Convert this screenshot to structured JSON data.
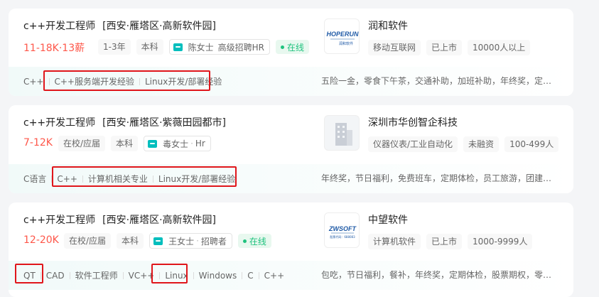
{
  "jobs": [
    {
      "title": "c++开发工程师",
      "area": "[西安·雁塔区·高新软件园]",
      "salary": "11-18K·13薪",
      "tags": [
        "1-3年",
        "本科"
      ],
      "hr": {
        "name": "陈女士",
        "title": "高级招聘HR"
      },
      "online": "在线",
      "company": {
        "name": "润和软件",
        "logo_text": "HOPERUN",
        "logo_sub": "润和软件",
        "logo_color": "#1f5aa6",
        "tags": [
          "移动互联网",
          "已上市",
          "10000人以上"
        ]
      },
      "skills": [
        "C++",
        "C++服务端开发经验",
        "Linux开发/部署经验"
      ],
      "benefits": "五险一金，零食下午茶，交通补助，加班补助，年终奖，定…"
    },
    {
      "title": "c++开发工程师",
      "area": "[西安·雁塔区·紫薇田园都市]",
      "salary": "7-12K",
      "tags": [
        "在校/应届",
        "本科"
      ],
      "hr": {
        "name": "毒女士",
        "title": "Hr"
      },
      "company": {
        "name": "深圳市华创智企科技",
        "tags": [
          "仪器仪表/工业自动化",
          "未融资",
          "100-499人"
        ]
      },
      "skills": [
        "C语言",
        "C++",
        "计算机相关专业",
        "Linux开发/部署经验"
      ],
      "benefits": "年终奖，节日福利，免费班车，定期体检，员工旅游，团建…"
    },
    {
      "title": "c++开发工程师",
      "area": "[西安·雁塔区·高新软件园]",
      "salary": "12-20K",
      "tags": [
        "在校/应届",
        "本科"
      ],
      "hr": {
        "name": "王女士",
        "title": "招聘者"
      },
      "online": "在线",
      "company": {
        "name": "中望软件",
        "logo_text": "ZWSOFT",
        "logo_sub": "股票代码：688083",
        "logo_color": "#1f5aa6",
        "tags": [
          "计算机软件",
          "已上市",
          "1000-9999人"
        ]
      },
      "skills": [
        "QT",
        "CAD",
        "软件工程师",
        "VC++",
        "Linux",
        "Windows",
        "C",
        "C++"
      ],
      "benefits": "包吃，节日福利，餐补，年终奖，定期体检，股票期权，零…"
    }
  ],
  "colors": {
    "salary": "#fe574a",
    "online": "#1fc27e",
    "accent": "#00bebd",
    "highlight": "#e0161b"
  },
  "icons": {
    "hr_chat": "chat-bubble-icon",
    "building": "building-icon"
  }
}
